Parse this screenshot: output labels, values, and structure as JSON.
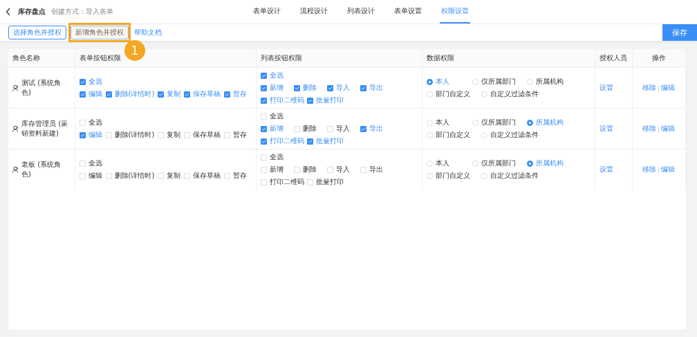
{
  "header": {
    "title": "库存盘点",
    "subtitle": "创建方式：导入表单"
  },
  "tabs": [
    {
      "label": "表单设计",
      "selected": false
    },
    {
      "label": "流程设计",
      "selected": false
    },
    {
      "label": "列表设计",
      "selected": false
    },
    {
      "label": "表单设置",
      "selected": false
    },
    {
      "label": "权限设置",
      "selected": true
    }
  ],
  "toolbar": {
    "buttons": [
      {
        "label": "选择角色并授权",
        "highlighted": false
      },
      {
        "label": "新增角色并授权",
        "highlighted": true
      }
    ],
    "link": "帮助文档",
    "save": "保存"
  },
  "annotation": {
    "number": "1"
  },
  "table": {
    "columns": [
      "角色名称",
      "表单按钮权限",
      "列表按钮权限",
      "数据权限",
      "授权人员",
      "操作"
    ],
    "rows": [
      {
        "role": "测试 (系统角色)",
        "form_select_all": {
          "label": "全选",
          "checked": true
        },
        "form_permissions": [
          {
            "label": "编辑",
            "checked": true
          },
          {
            "label": "删除(详情时)",
            "checked": true
          },
          {
            "label": "复制",
            "checked": true
          },
          {
            "label": "保存草稿",
            "checked": true
          },
          {
            "label": "暂存",
            "checked": true
          }
        ],
        "list_select_all": {
          "label": "全选",
          "checked": true
        },
        "list_permissions": [
          {
            "label": "新增",
            "checked": true
          },
          {
            "label": "删除",
            "checked": true
          },
          {
            "label": "导入",
            "checked": true
          },
          {
            "label": "导出",
            "checked": true
          },
          {
            "label": "打印二维码",
            "checked": true
          },
          {
            "label": "批量打印",
            "checked": true
          }
        ],
        "data_scope": [
          {
            "label": "本人",
            "selected": true
          },
          {
            "label": "仅所属部门",
            "selected": false
          },
          {
            "label": "所属机构",
            "selected": false
          },
          {
            "label": "部门自定义",
            "selected": false
          },
          {
            "label": "自定义过滤条件",
            "selected": false
          }
        ],
        "authorized": "设置",
        "actions": [
          "移除",
          "编辑"
        ]
      },
      {
        "role": "库存管理员 (采销资料新建)",
        "form_select_all": {
          "label": "全选",
          "checked": false
        },
        "form_permissions": [
          {
            "label": "编辑",
            "checked": true
          },
          {
            "label": "删除(详情时)",
            "checked": false
          },
          {
            "label": "复制",
            "checked": false
          },
          {
            "label": "保存草稿",
            "checked": false
          },
          {
            "label": "暂存",
            "checked": false
          }
        ],
        "list_select_all": {
          "label": "全选",
          "checked": false
        },
        "list_permissions": [
          {
            "label": "新增",
            "checked": true
          },
          {
            "label": "删除",
            "checked": false
          },
          {
            "label": "导入",
            "checked": false
          },
          {
            "label": "导出",
            "checked": true
          },
          {
            "label": "打印二维码",
            "checked": true
          },
          {
            "label": "批量打印",
            "checked": true
          }
        ],
        "data_scope": [
          {
            "label": "本人",
            "selected": false
          },
          {
            "label": "仅所属部门",
            "selected": false
          },
          {
            "label": "所属机构",
            "selected": true
          },
          {
            "label": "部门自定义",
            "selected": false
          },
          {
            "label": "自定义过滤条件",
            "selected": false
          }
        ],
        "authorized": "设置",
        "actions": [
          "移除",
          "编辑"
        ]
      },
      {
        "role": "老板 (系统角色)",
        "form_select_all": {
          "label": "全选",
          "checked": false
        },
        "form_permissions": [
          {
            "label": "编辑",
            "checked": false
          },
          {
            "label": "删除(详情时)",
            "checked": false
          },
          {
            "label": "复制",
            "checked": false
          },
          {
            "label": "保存草稿",
            "checked": false
          },
          {
            "label": "暂存",
            "checked": false
          }
        ],
        "list_select_all": {
          "label": "全选",
          "checked": false
        },
        "list_permissions": [
          {
            "label": "新增",
            "checked": false
          },
          {
            "label": "删除",
            "checked": false
          },
          {
            "label": "导入",
            "checked": false
          },
          {
            "label": "导出",
            "checked": false
          },
          {
            "label": "打印二维码",
            "checked": false
          },
          {
            "label": "批量打印",
            "checked": false
          }
        ],
        "data_scope": [
          {
            "label": "本人",
            "selected": false
          },
          {
            "label": "仅所属部门",
            "selected": false
          },
          {
            "label": "所属机构",
            "selected": true
          },
          {
            "label": "部门自定义",
            "selected": false
          },
          {
            "label": "自定义过滤条件",
            "selected": false
          }
        ],
        "authorized": "设置",
        "actions": [
          "移除",
          "编辑"
        ]
      }
    ]
  }
}
